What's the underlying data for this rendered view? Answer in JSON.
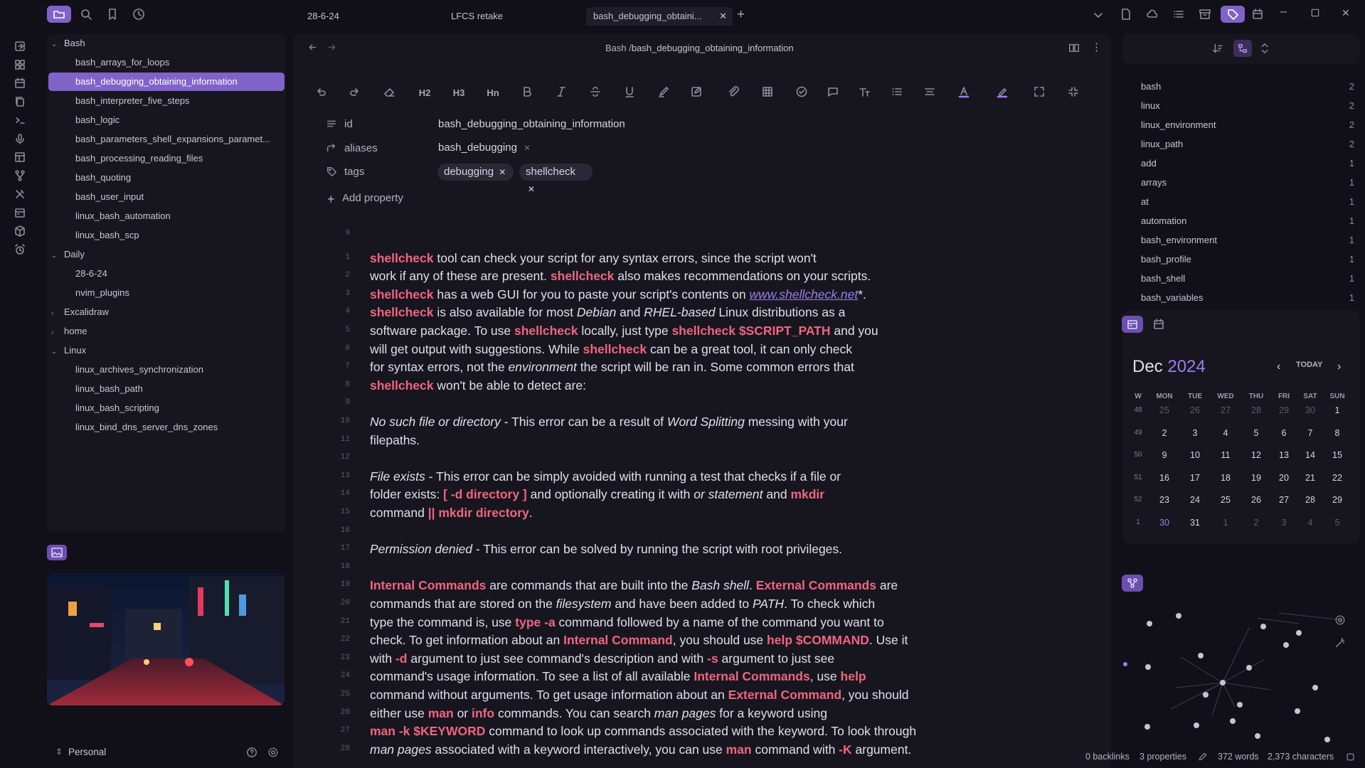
{
  "tabs": [
    {
      "label": "28-6-24"
    },
    {
      "label": "LFCS retake"
    },
    {
      "label": "bash_debugging_obtaini..."
    }
  ],
  "breadcrumb": {
    "folder": "Bash",
    "separator": "/",
    "file": "bash_debugging_obtaining_information"
  },
  "file_tree": {
    "folders": [
      {
        "name": "Bash",
        "files": [
          "bash_arrays_for_loops",
          "bash_debugging_obtaining_information",
          "bash_interpreter_five_steps",
          "bash_logic",
          "bash_parameters_shell_expansions_paramet...",
          "bash_processing_reading_files",
          "bash_quoting",
          "bash_user_input",
          "linux_bash_automation",
          "linux_bash_scp"
        ]
      },
      {
        "name": "Daily",
        "files": [
          "28-6-24",
          "nvim_plugins"
        ]
      },
      {
        "name": "Excalidraw",
        "files": []
      },
      {
        "name": "home",
        "files": []
      },
      {
        "name": "Linux",
        "files": [
          "linux_archives_synchronization",
          "linux_bash_path",
          "linux_bash_scripting",
          "linux_bind_dns_server_dns_zones"
        ]
      }
    ],
    "active_file": "bash_debugging_obtaining_information"
  },
  "vault": {
    "name": "Personal"
  },
  "properties": {
    "id_label": "id",
    "id_value": "bash_debugging_obtaining_information",
    "aliases_label": "aliases",
    "aliases_value": "bash_debugging",
    "tags_label": "tags",
    "tags": [
      "debugging",
      "shellcheck"
    ],
    "add_label": "Add property"
  },
  "toolbar": {
    "h2": "H2",
    "h3": "H3",
    "hn": "Hn"
  },
  "editor_lines": [
    {
      "n": "9",
      "html": ""
    },
    {
      "n": "1",
      "html": "<span class='k'>shellcheck</span> tool can check your script for any syntax errors, since the script won't"
    },
    {
      "n": "2",
      "html": "work if any of these are present. <span class='k'>shellcheck</span> also makes recommendations on your scripts."
    },
    {
      "n": "3",
      "html": "<span class='k'>shellcheck</span> has a web GUI for you to paste your script's contents on <span class='lnk'>www.shellcheck.net</span>*."
    },
    {
      "n": "4",
      "html": "<span class='k'>shellcheck</span> is also available for most <i>Debian</i> and <i>RHEL-based</i> Linux distributions as a"
    },
    {
      "n": "5",
      "html": "software package. To use <span class='k'>shellcheck</span> locally, just type <span class='k'>shellcheck $SCRIPT_PATH</span> and you"
    },
    {
      "n": "6",
      "html": "will get output with suggestions. While <span class='k'>shellcheck</span> can be a great tool, it can only check"
    },
    {
      "n": "7",
      "html": "for syntax errors, not the <i>environment</i> the script will be ran in. Some common errors that"
    },
    {
      "n": "8",
      "html": "<span class='k'>shellcheck</span> won't be able to detect are:"
    },
    {
      "n": "9",
      "html": ""
    },
    {
      "n": "10",
      "html": "<i>No such file or directory</i> - This error can be a result of <i>Word Splitting</i> messing with your"
    },
    {
      "n": "11",
      "html": "filepaths."
    },
    {
      "n": "12",
      "html": ""
    },
    {
      "n": "13",
      "html": "<i>File exists</i> - This error can be simply avoided with running a test that checks if a file or"
    },
    {
      "n": "14",
      "html": "folder exists: <span class='k'>[ -d directory ]</span> and optionally creating it with <i>or statement</i> and <span class='k'>mkdir</span>"
    },
    {
      "n": "15",
      "html": "command <span class='k'>|| mkdir directory</span>."
    },
    {
      "n": "16",
      "html": ""
    },
    {
      "n": "17",
      "html": "<i>Permission denied</i> - This error can be solved by running the script with root privileges."
    },
    {
      "n": "18",
      "html": ""
    },
    {
      "n": "19",
      "html": "<span class='k'>Internal Commands</span> are commands that are built into the <i>Bash shell</i>. <span class='k'>External Commands</span> are"
    },
    {
      "n": "20",
      "html": "commands that are stored on the <i>filesystem</i> and have been added to <i>PATH</i>. To check which"
    },
    {
      "n": "21",
      "html": "type the command is, use <span class='k'>type -a</span> command followed by a name of the command you want to"
    },
    {
      "n": "22",
      "html": "check. To get information about an <span class='k'>Internal Command</span>, you should use <span class='k'>help $COMMAND</span>. Use it"
    },
    {
      "n": "23",
      "html": "with <span class='k'>-d</span> argument to just see command's description and with <span class='k'>-s</span> argument to just see"
    },
    {
      "n": "24",
      "html": "command's usage information. To see a list of all available <span class='k'>Internal Commands</span>, use <span class='k'>help</span>"
    },
    {
      "n": "25",
      "html": "command without arguments. To get usage information about an <span class='k'>External Command</span>, you should"
    },
    {
      "n": "26",
      "html": "either use <span class='k'>man</span> or <span class='k'>info</span> commands. You can search <i>man pages</i> for a keyword using"
    },
    {
      "n": "27",
      "html": "<span class='k'>man -k $KEYWORD</span> command to look up commands associated with the keyword. To look through"
    },
    {
      "n": "28",
      "html": "<i>man pages</i> associated with a keyword interactively, you can use <span class='k'>man</span> command with <span class='k'>-K</span> argument."
    }
  ],
  "tag_pane": [
    {
      "name": "bash",
      "count": "2"
    },
    {
      "name": "linux",
      "count": "2"
    },
    {
      "name": "linux_environment",
      "count": "2"
    },
    {
      "name": "linux_path",
      "count": "2"
    },
    {
      "name": "add",
      "count": "1"
    },
    {
      "name": "arrays",
      "count": "1"
    },
    {
      "name": "at",
      "count": "1"
    },
    {
      "name": "automation",
      "count": "1"
    },
    {
      "name": "bash_environment",
      "count": "1"
    },
    {
      "name": "bash_profile",
      "count": "1"
    },
    {
      "name": "bash_shell",
      "count": "1"
    },
    {
      "name": "bash_variables",
      "count": "1"
    }
  ],
  "calendar": {
    "month": "Dec",
    "year": "2024",
    "today_label": "TODAY",
    "headers": [
      "W",
      "MON",
      "TUE",
      "WED",
      "THU",
      "FRI",
      "SAT",
      "SUN"
    ],
    "weeks": [
      {
        "w": "48",
        "days": [
          "25",
          "26",
          "27",
          "28",
          "29",
          "30",
          "1"
        ],
        "dim": [
          1,
          1,
          1,
          1,
          1,
          1,
          0
        ]
      },
      {
        "w": "49",
        "days": [
          "2",
          "3",
          "4",
          "5",
          "6",
          "7",
          "8"
        ],
        "dim": [
          0,
          0,
          0,
          0,
          0,
          0,
          0
        ]
      },
      {
        "w": "50",
        "days": [
          "9",
          "10",
          "11",
          "12",
          "13",
          "14",
          "15"
        ],
        "dim": [
          0,
          0,
          0,
          0,
          0,
          0,
          0
        ]
      },
      {
        "w": "51",
        "days": [
          "16",
          "17",
          "18",
          "19",
          "20",
          "21",
          "22"
        ],
        "dim": [
          0,
          0,
          0,
          0,
          0,
          0,
          0
        ]
      },
      {
        "w": "52",
        "days": [
          "23",
          "24",
          "25",
          "26",
          "27",
          "28",
          "29"
        ],
        "dim": [
          0,
          0,
          0,
          0,
          0,
          0,
          0
        ]
      },
      {
        "w": "1",
        "days": [
          "30",
          "31",
          "1",
          "2",
          "3",
          "4",
          "5"
        ],
        "dim": [
          0,
          0,
          1,
          1,
          1,
          1,
          1
        ]
      }
    ],
    "today": "30"
  },
  "status": {
    "backlinks": "0 backlinks",
    "properties": "3 properties",
    "words": "372 words",
    "characters": "2,373 characters"
  },
  "colors": {
    "accent": "#7f63c9",
    "keyword": "#f0657f",
    "link": "#9a7de8",
    "bg": "#111018",
    "pane": "#17161f"
  }
}
